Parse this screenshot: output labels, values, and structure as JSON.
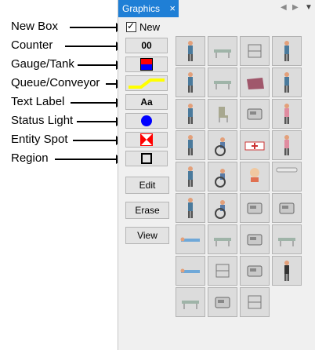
{
  "callouts": [
    {
      "key": "new_box",
      "label": "New Box"
    },
    {
      "key": "counter",
      "label": "Counter"
    },
    {
      "key": "gauge",
      "label": "Gauge/Tank"
    },
    {
      "key": "queue",
      "label": "Queue/Conveyor"
    },
    {
      "key": "text",
      "label": "Text Label"
    },
    {
      "key": "status",
      "label": "Status Light"
    },
    {
      "key": "entity",
      "label": "Entity Spot"
    },
    {
      "key": "region",
      "label": "Region"
    }
  ],
  "tab": {
    "title": "Graphics",
    "close_icon": "×"
  },
  "new_checkbox": {
    "label": "New",
    "checked": true
  },
  "tools": {
    "counter_text": "00",
    "text_label_text": "Aa"
  },
  "buttons": {
    "edit": "Edit",
    "erase": "Erase",
    "view": "View"
  },
  "colors": {
    "tab_active": "#1f7fd6",
    "gauge_red": "#ff0000",
    "gauge_blue": "#0000ff",
    "queue_yellow": "#ffff00",
    "status_blue": "#0000ff",
    "entity_red": "#ff0000"
  },
  "library": [
    [
      "person-seated-icon",
      "gurney-icon",
      "cart-icon",
      "person-icon"
    ],
    [
      "person-standing-icon",
      "stretcher-icon",
      "blanket-icon",
      "person-icon"
    ],
    [
      "person-standing-icon",
      "chair-icon",
      "desk-icon",
      "person-pink-icon"
    ],
    [
      "person-standing-icon",
      "wheelchair-icon",
      "ambulance-icon",
      "person-seated-pink-icon"
    ],
    [
      "person-standing-icon",
      "person-wheelchair-icon",
      "person-bald-icon",
      "blank-bar-icon"
    ],
    [
      "person-standing-icon",
      "person-wheelchair-icon",
      "machine-icon",
      "equipment-icon"
    ],
    [
      "patient-lying-icon",
      "bed-icon",
      "scale-icon",
      "stretcher-icon"
    ],
    [
      "patient-lying-icon",
      "cabinet-icon",
      "microscope-icon",
      "person-dark-icon"
    ],
    [
      "stretcher-green-icon",
      "printer-icon",
      "rack-icon"
    ]
  ]
}
